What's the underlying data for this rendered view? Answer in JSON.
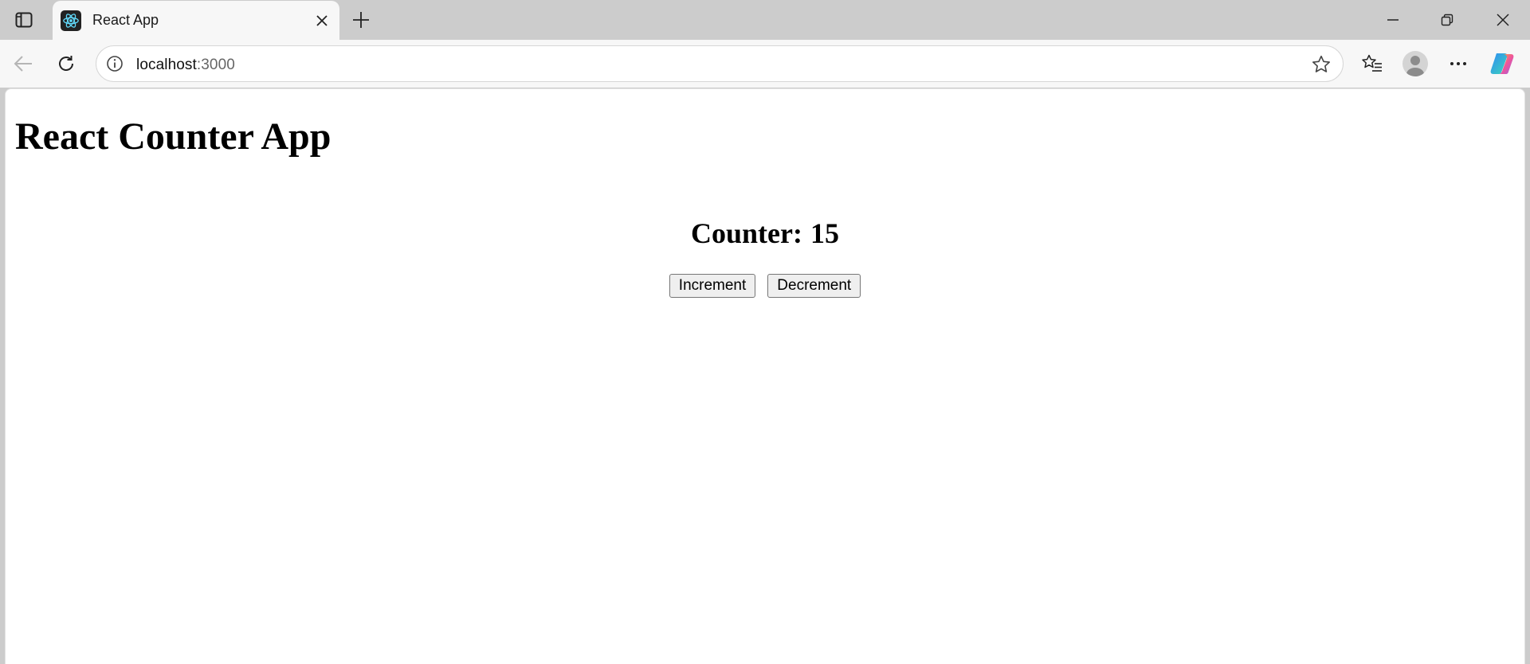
{
  "browser": {
    "tab_title": "React App",
    "url_host": "localhost",
    "url_port": ":3000"
  },
  "page": {
    "heading": "React Counter App",
    "counter_label": "Counter:",
    "counter_value": 15,
    "increment_label": "Increment",
    "decrement_label": "Decrement"
  },
  "icons": {
    "tab_actions": "tab-actions-icon",
    "favicon": "react-logo-icon",
    "tab_close": "close-icon",
    "new_tab": "plus-icon",
    "minimize": "minimize-icon",
    "restore": "restore-icon",
    "close_window": "close-icon",
    "back": "back-arrow-icon",
    "refresh": "refresh-icon",
    "site_info": "info-icon",
    "favorite": "star-icon",
    "favorites": "favorites-icon",
    "profile": "profile-icon",
    "more": "more-icon",
    "copilot": "copilot-icon"
  },
  "colors": {
    "react_cyan": "#61dafb",
    "chrome_bg": "#cccccc",
    "toolbar_bg": "#f7f7f7"
  }
}
